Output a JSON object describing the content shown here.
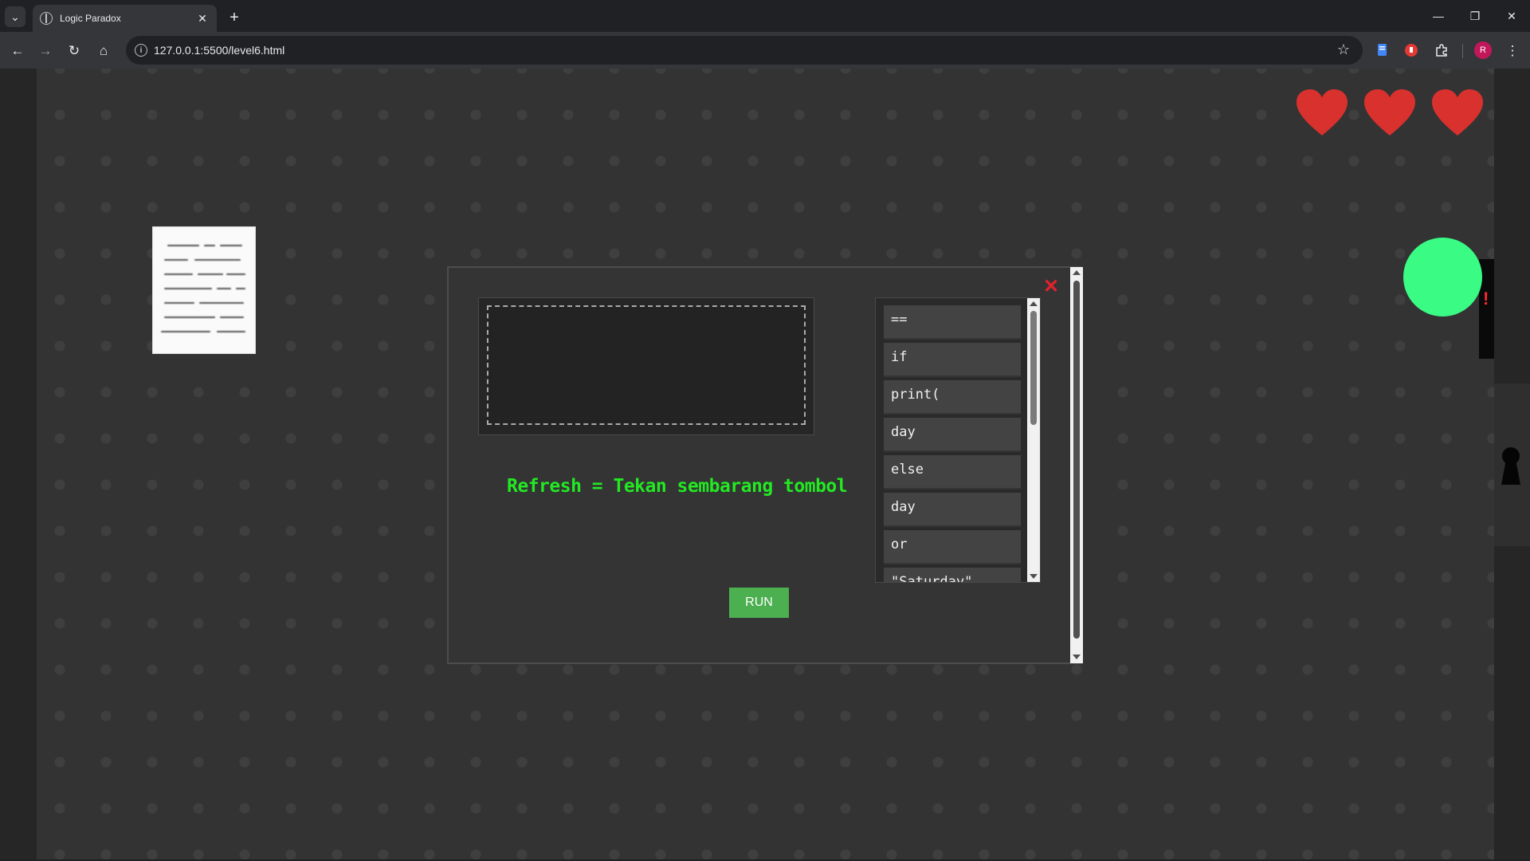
{
  "browser": {
    "tab_title": "Logic Paradox",
    "url": "127.0.0.1:5500/level6.html",
    "profile_initial": "R",
    "tab_close_glyph": "✕",
    "new_tab_glyph": "+",
    "minimize_glyph": "—",
    "restore_glyph": "❐",
    "close_glyph": "✕",
    "back_glyph": "←",
    "forward_glyph": "→",
    "reload_glyph": "↻",
    "home_glyph": "⌂",
    "star_glyph": "☆",
    "menu_glyph": "⋮",
    "tab_list_glyph": "⌄"
  },
  "game": {
    "lives": 3,
    "heart_color": "#d8312e",
    "orb_color": "#3afb84",
    "alert_glyph": "!"
  },
  "modal": {
    "close_glyph": "✕",
    "hint_text": "Refresh = Tekan sembarang tombol",
    "run_label": "RUN",
    "tokens": [
      "==",
      "if",
      "print(",
      "day",
      "else",
      "day",
      "or",
      "\"Saturday\""
    ]
  },
  "colors": {
    "hint": "#23e823",
    "run_button": "#4caf50",
    "close_x": "#e3222b"
  }
}
